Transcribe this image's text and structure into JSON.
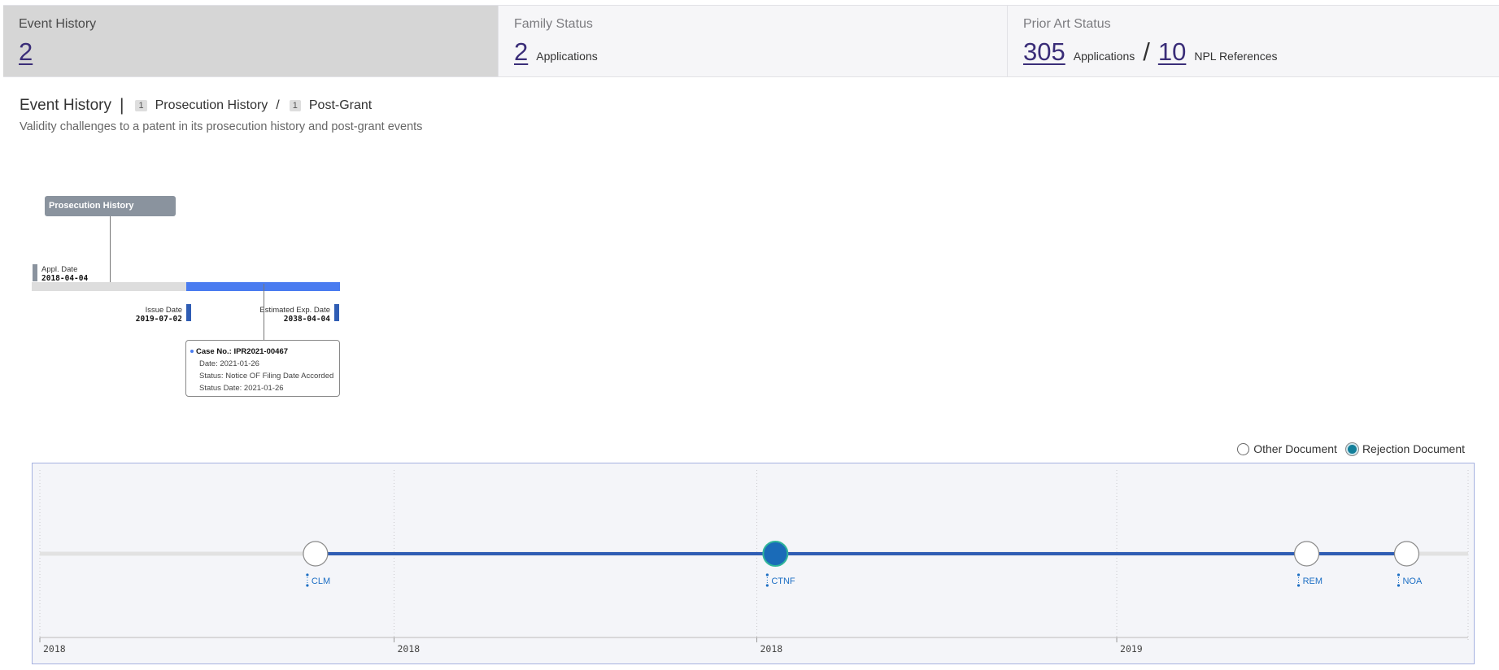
{
  "stats": {
    "event_history": {
      "title": "Event History",
      "value": "2"
    },
    "family_status": {
      "title": "Family Status",
      "value": "2",
      "unit": "Applications"
    },
    "prior_art": {
      "title": "Prior Art Status",
      "applications_value": "305",
      "applications_unit": "Applications",
      "slash": "/",
      "npl_value": "10",
      "npl_unit": "NPL References"
    }
  },
  "section": {
    "title": "Event History",
    "separator": "|",
    "prosecution_count": "1",
    "prosecution_label": "Prosecution History",
    "crumb_sep": "/",
    "postgrant_count": "1",
    "postgrant_label": "Post-Grant",
    "description": "Validity challenges to a patent in its prosecution history and post-grant events"
  },
  "prosecution": {
    "label": "Prosecution History",
    "appl_label": "Appl. Date",
    "appl_date": "2018-04-04",
    "issue_label": "Issue Date",
    "issue_date": "2019-07-02",
    "exp_label": "Estimated Exp. Date",
    "exp_date": "2038-04-04",
    "case": {
      "title": "Case No.: IPR2021-00467",
      "date": "Date: 2021-01-26",
      "status": "Status: Notice OF Filing Date Accorded",
      "status_date": "Status Date: 2021-01-26"
    }
  },
  "legend": {
    "other": "Other Document",
    "rejection": "Rejection Document"
  },
  "colors": {
    "accent": "#3a2d78",
    "timeline_blue": "#2f5db4",
    "rejection": "#1a6bb8",
    "bar_blue": "#4a7cf0",
    "label_blue": "#1d6fc4"
  },
  "chart_data": {
    "type": "scatter",
    "events": [
      {
        "label": "CLM",
        "kind": "other",
        "pos": 0.193
      },
      {
        "label": "CTNF",
        "kind": "rejection",
        "pos": 0.515
      },
      {
        "label": "REM",
        "kind": "other",
        "pos": 0.887
      },
      {
        "label": "NOA",
        "kind": "other",
        "pos": 0.957
      }
    ],
    "axis_ticks": [
      {
        "label": "2018",
        "pos": 0.0
      },
      {
        "label": "2018",
        "pos": 0.248
      },
      {
        "label": "2018",
        "pos": 0.502
      },
      {
        "label": "2019",
        "pos": 0.754
      }
    ]
  }
}
